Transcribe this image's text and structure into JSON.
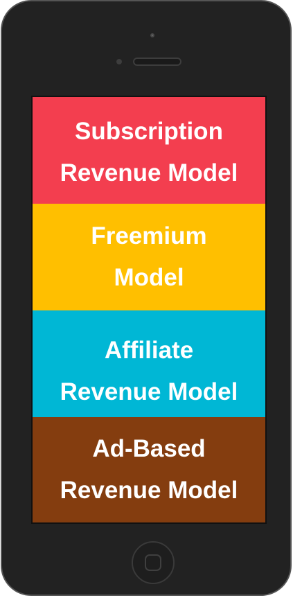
{
  "bands": [
    {
      "label": "Subscription Revenue Model",
      "color": "#F33E4F"
    },
    {
      "label": "Freemium Model",
      "color": "#FFBF00"
    },
    {
      "label": "Affiliate Revenue Model",
      "color": "#00B7D5"
    },
    {
      "label": "Ad-Based Revenue Model",
      "color": "#843D0F"
    }
  ],
  "device": {
    "body_color": "#222222",
    "icon": "smartphone-icon"
  }
}
